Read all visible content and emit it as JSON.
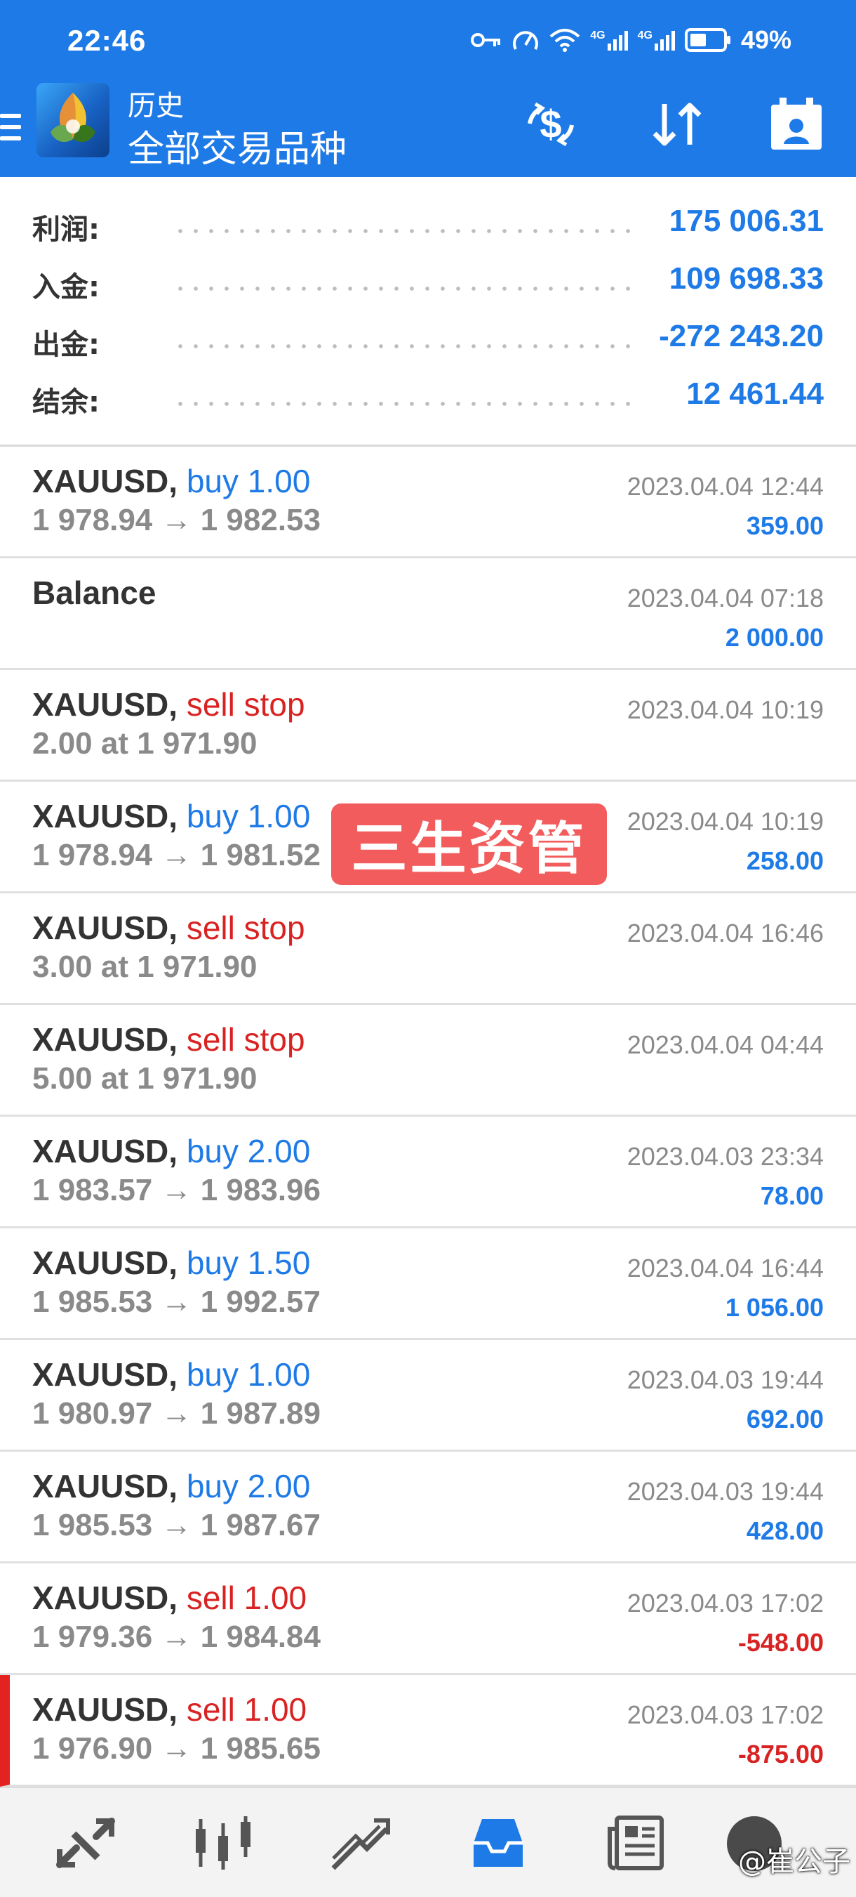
{
  "status_bar": {
    "time": "22:46",
    "battery": "49%",
    "network_1": "4G",
    "network_2": "4G"
  },
  "toolbar": {
    "title": "历史",
    "subtitle": "全部交易品种",
    "icons": [
      "menu-icon",
      "metatrader-logo",
      "currency-exchange-icon",
      "sort-icon",
      "calendar-icon"
    ]
  },
  "summary": [
    {
      "label": "利润:",
      "value": "175 006.31"
    },
    {
      "label": "入金:",
      "value": "109 698.33"
    },
    {
      "label": "出金:",
      "value": "-272 243.20"
    },
    {
      "label": "结余:",
      "value": "12 461.44"
    }
  ],
  "deals": [
    {
      "symbol": "XAUUSD,",
      "action": "buy 1.00",
      "side": "buy",
      "prices": "1 978.94 → 1 982.53",
      "time": "2023.04.04 12:44",
      "profit": "359.00"
    },
    {
      "symbol": "Balance",
      "action": "",
      "side": "",
      "prices": "",
      "time": "2023.04.04 07:18",
      "profit": "2 000.00"
    },
    {
      "symbol": "XAUUSD,",
      "action": "sell stop",
      "side": "sell",
      "prices": "2.00 at 1 971.90",
      "time": "2023.04.04 10:19",
      "profit": ""
    },
    {
      "symbol": "XAUUSD,",
      "action": "buy 1.00",
      "side": "buy",
      "prices": "1 978.94 → 1 981.52",
      "time": "2023.04.04 10:19",
      "profit": "258.00"
    },
    {
      "symbol": "XAUUSD,",
      "action": "sell stop",
      "side": "sell",
      "prices": "3.00 at 1 971.90",
      "time": "2023.04.04 16:46",
      "profit": ""
    },
    {
      "symbol": "XAUUSD,",
      "action": "sell stop",
      "side": "sell",
      "prices": "5.00 at 1 971.90",
      "time": "2023.04.04 04:44",
      "profit": ""
    },
    {
      "symbol": "XAUUSD,",
      "action": "buy 2.00",
      "side": "buy",
      "prices": "1 983.57 → 1 983.96",
      "time": "2023.04.03 23:34",
      "profit": "78.00"
    },
    {
      "symbol": "XAUUSD,",
      "action": "buy 1.50",
      "side": "buy",
      "prices": "1 985.53 → 1 992.57",
      "time": "2023.04.04 16:44",
      "profit": "1 056.00"
    },
    {
      "symbol": "XAUUSD,",
      "action": "buy 1.00",
      "side": "buy",
      "prices": "1 980.97 → 1 987.89",
      "time": "2023.04.03 19:44",
      "profit": "692.00"
    },
    {
      "symbol": "XAUUSD,",
      "action": "buy 2.00",
      "side": "buy",
      "prices": "1 985.53 → 1 987.67",
      "time": "2023.04.03 19:44",
      "profit": "428.00"
    },
    {
      "symbol": "XAUUSD,",
      "action": "sell 1.00",
      "side": "sell",
      "prices": "1 979.36 → 1 984.84",
      "time": "2023.04.03 17:02",
      "profit": "-548.00"
    },
    {
      "symbol": "XAUUSD,",
      "action": "sell 1.00",
      "side": "sell",
      "prices": "1 976.90 → 1 985.65",
      "time": "2023.04.03 17:02",
      "profit": "-875.00"
    }
  ],
  "watermark": "三生资管",
  "bottom_nav": {
    "icons": [
      "quotes-icon",
      "chart-icon",
      "trade-icon",
      "history-icon",
      "news-icon",
      "messages-icon"
    ],
    "active": "history-icon"
  },
  "attribution": "@崔公子",
  "colors": {
    "accent": "#1e7ae6",
    "negative": "#d92323",
    "badge": "#f25c5c"
  }
}
